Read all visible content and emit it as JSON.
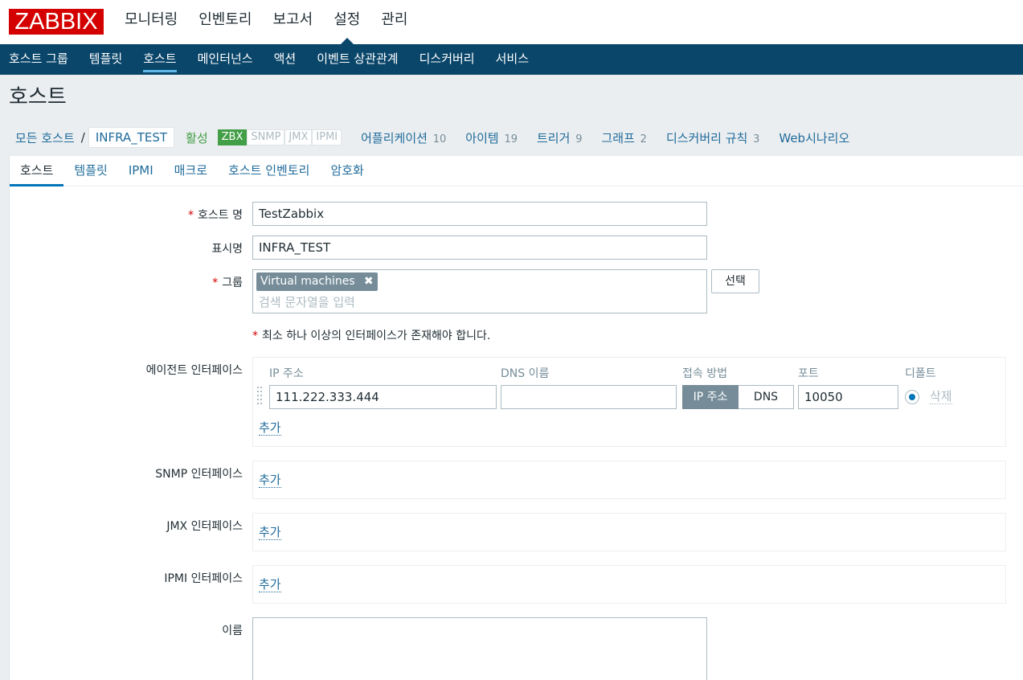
{
  "header": {
    "logo": "ZABBIX",
    "main_menu": [
      "모니터링",
      "인벤토리",
      "보고서",
      "설정",
      "관리"
    ]
  },
  "sub_menu": [
    "호스트 그룹",
    "템플릿",
    "호스트",
    "메인터넌스",
    "액션",
    "이벤트 상관관계",
    "디스커버리",
    "서비스"
  ],
  "page": {
    "title": "호스트"
  },
  "breadcrumb": {
    "all_hosts": "모든 호스트",
    "separator": "/",
    "current": "INFRA_TEST",
    "status": "활성",
    "availability": [
      "ZBX",
      "SNMP",
      "JMX",
      "IPMI"
    ],
    "stats": [
      {
        "label": "어플리케이션",
        "count": "10"
      },
      {
        "label": "아이템",
        "count": "19"
      },
      {
        "label": "트리거",
        "count": "9"
      },
      {
        "label": "그래프",
        "count": "2"
      },
      {
        "label": "디스커버리 규칙",
        "count": "3"
      },
      {
        "label": "Web시나리오",
        "count": ""
      }
    ]
  },
  "tabs": [
    "호스트",
    "템플릿",
    "IPMI",
    "매크로",
    "호스트 인벤토리",
    "암호화"
  ],
  "form": {
    "host_name_label": "호스트 명",
    "host_name_value": "TestZabbix",
    "visible_name_label": "표시명",
    "visible_name_value": "INFRA_TEST",
    "groups_label": "그룹",
    "group_chip": "Virtual machines",
    "group_remove": "✖",
    "groups_placeholder": "검색 문자열을 입력",
    "select_button": "선택",
    "req_star": "*",
    "interface_hint": "최소 하나 이상의 인터페이스가 존재해야 합니다.",
    "agent_label": "에이전트 인터페이스",
    "agent": {
      "col_ip": "IP 주소",
      "col_dns": "DNS 이름",
      "col_connect": "접속 방법",
      "col_port": "포트",
      "col_default": "디폴트",
      "ip_value": "111.222.333.444",
      "dns_value": "",
      "connect_ip": "IP 주소",
      "connect_dns": "DNS",
      "port_value": "10050",
      "remove": "삭제",
      "add": "추가"
    },
    "snmp_label": "SNMP 인터페이스",
    "snmp_add": "추가",
    "jmx_label": "JMX 인터페이스",
    "jmx_add": "추가",
    "ipmi_label": "IPMI 인터페이스",
    "ipmi_add": "추가",
    "description_label": "이름"
  }
}
